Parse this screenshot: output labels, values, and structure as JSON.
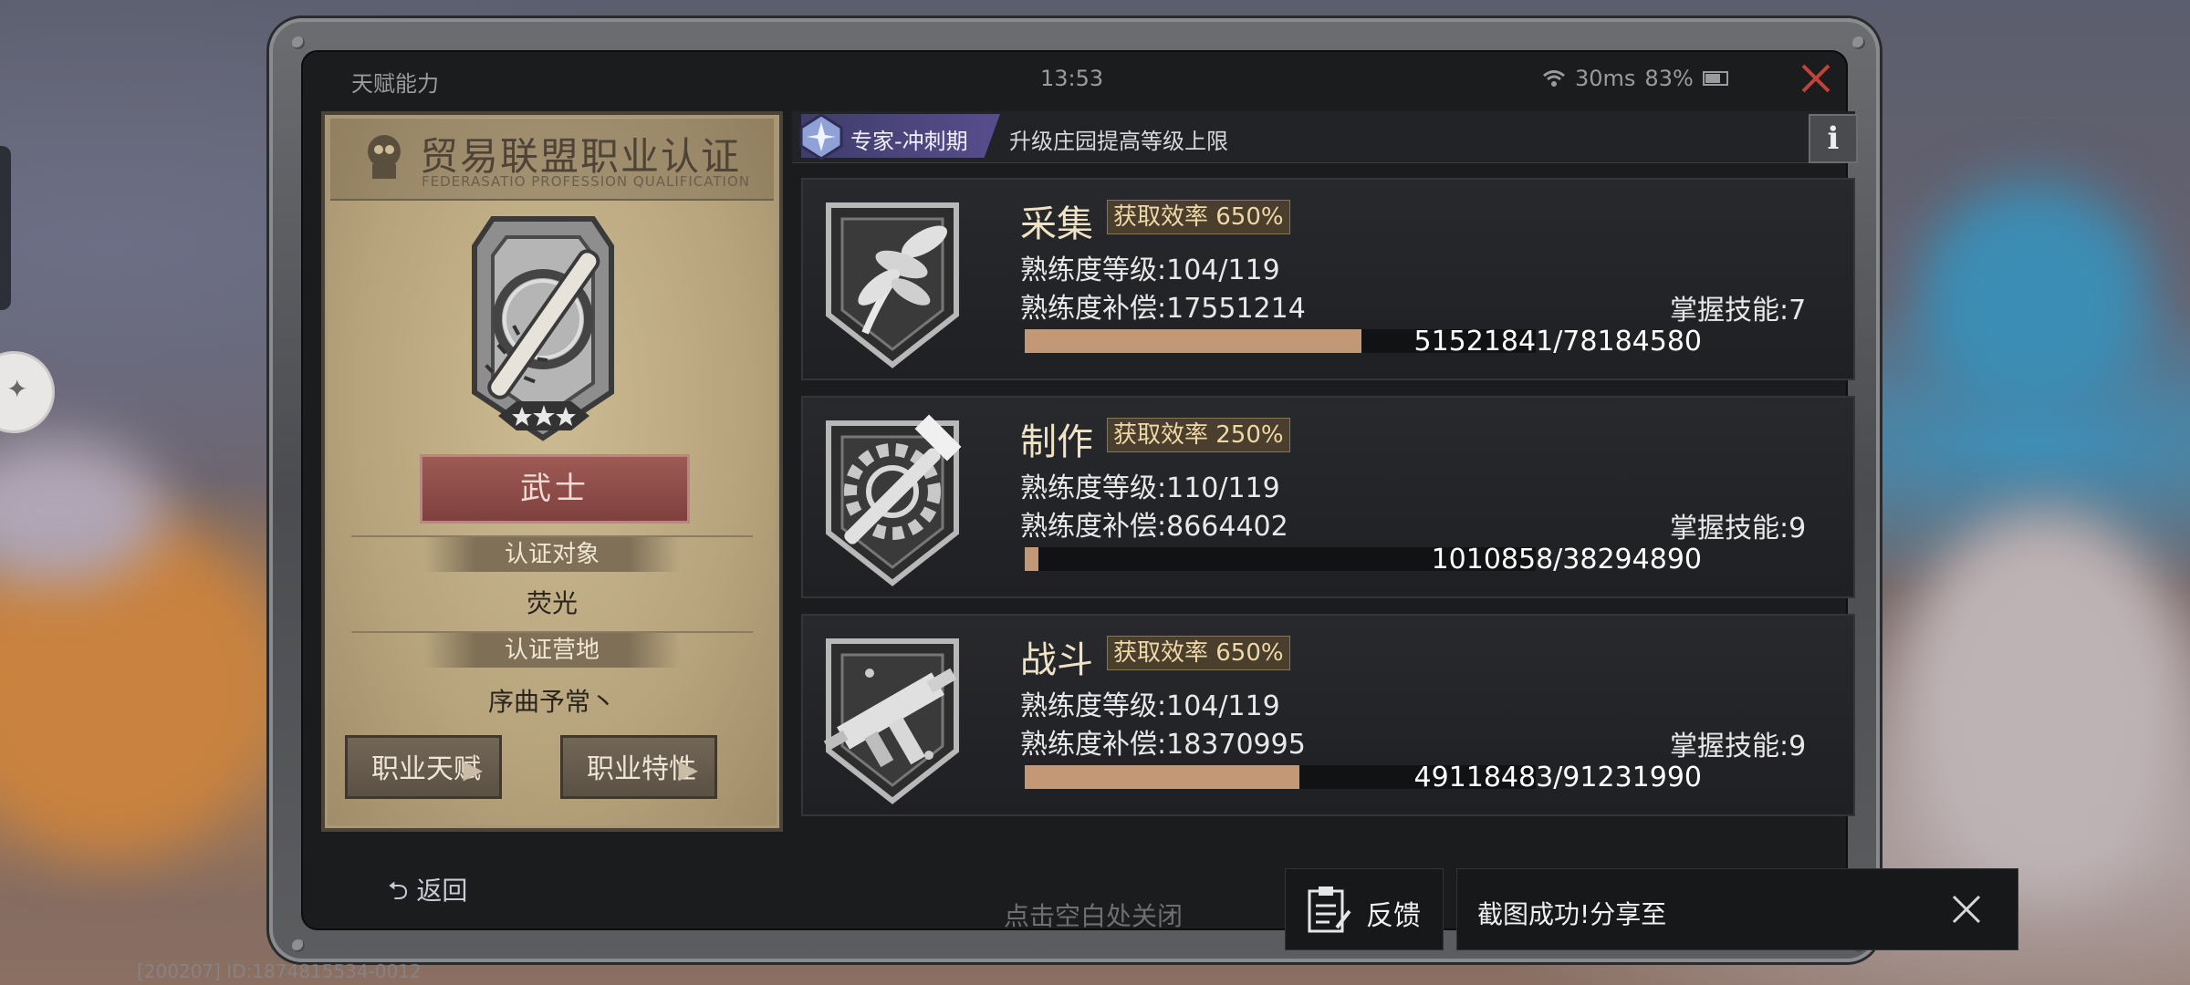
{
  "header": {
    "title": "天赋能力",
    "time": "13:53",
    "ping": "30ms",
    "battery": "83%"
  },
  "card": {
    "title": "贸易联盟职业认证",
    "subtitle": "FEDERASATIO PROFESSION QUALIFICATION",
    "star_rating": 3,
    "class_name": "武士",
    "target_label": "认证对象",
    "target_value": "荧光",
    "camp_label": "认证营地",
    "camp_value": "序曲予常丶",
    "btn_talent": "职业天赋",
    "btn_trait": "职业特性"
  },
  "strip": {
    "tag": "专家-冲刺期",
    "text": "升级庄园提高等级上限",
    "info": "i"
  },
  "skills": [
    {
      "name": "采集",
      "efficiency": "获取效率 650%",
      "level": "熟练度等级:104/119",
      "compensation": "熟练度补偿:17551214",
      "mastered": "掌握技能:7",
      "progress_text": "51521841/78184580",
      "progress": 0.659,
      "icon": "leaf-icon"
    },
    {
      "name": "制作",
      "efficiency": "获取效率 250%",
      "level": "熟练度等级:110/119",
      "compensation": "熟练度补偿:8664402",
      "mastered": "掌握技能:9",
      "progress_text": "1010858/38294890",
      "progress": 0.026,
      "icon": "hammer-gear-icon"
    },
    {
      "name": "战斗",
      "efficiency": "获取效率 650%",
      "level": "熟练度等级:104/119",
      "compensation": "熟练度补偿:18370995",
      "mastered": "掌握技能:9",
      "progress_text": "49118483/91231990",
      "progress": 0.538,
      "icon": "gun-icon"
    }
  ],
  "footer": {
    "back": "返回",
    "hint": "点击空白处关闭",
    "watermark": "[200207] ID:1874815534-0012"
  },
  "toast": {
    "feedback": "反馈",
    "message": "截图成功!分享至"
  },
  "colors": {
    "bar": "#c29876",
    "class_button": "#8d4b47",
    "tag": "#4f4a84"
  }
}
